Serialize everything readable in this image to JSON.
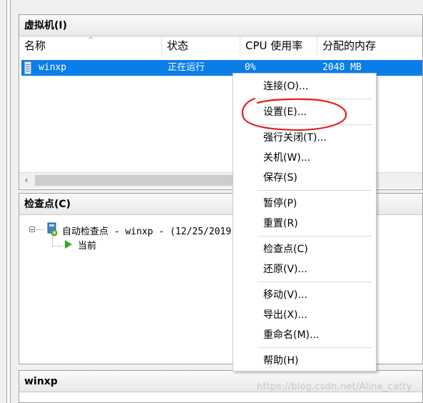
{
  "vm_panel": {
    "title": "虚拟机(I)",
    "columns": [
      "名称",
      "状态",
      "CPU 使用率",
      "分配的内存"
    ],
    "rows": [
      {
        "name": "winxp",
        "status": "正在运行",
        "cpu": "0%",
        "memory": "2048 MB"
      }
    ],
    "scroll_left_glyph": "‹"
  },
  "checkpoint_panel": {
    "title": "检查点(C)",
    "items": [
      {
        "label": "自动检查点 - winxp - (12/25/2019"
      },
      {
        "label": "当前"
      }
    ]
  },
  "bottom_panel": {
    "title": "winxp"
  },
  "context_menu": {
    "items": [
      "连接(O)...",
      "设置(E)...",
      "强行关闭(T)...",
      "关机(W)...",
      "保存(S)",
      "暂停(P)",
      "重置(R)",
      "检查点(C)",
      "还原(V)...",
      "移动(V)...",
      "导出(X)...",
      "重命名(M)...",
      "帮助(H)"
    ]
  },
  "watermark": "https://blog.csdn.net/Alina_catty",
  "colors": {
    "selection": "#0a7ee8",
    "annotation": "#e02020",
    "current_play": "#28b028"
  }
}
